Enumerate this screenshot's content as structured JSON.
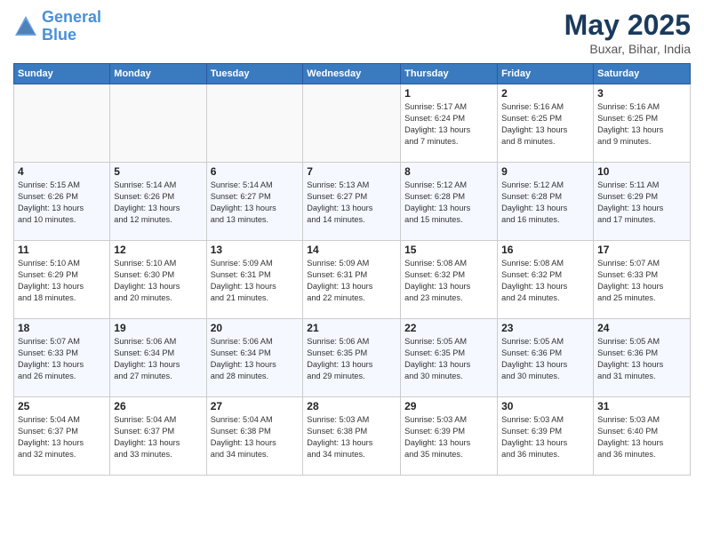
{
  "header": {
    "logo_line1": "General",
    "logo_line2": "Blue",
    "month": "May 2025",
    "location": "Buxar, Bihar, India"
  },
  "weekdays": [
    "Sunday",
    "Monday",
    "Tuesday",
    "Wednesday",
    "Thursday",
    "Friday",
    "Saturday"
  ],
  "weeks": [
    [
      {
        "day": "",
        "info": ""
      },
      {
        "day": "",
        "info": ""
      },
      {
        "day": "",
        "info": ""
      },
      {
        "day": "",
        "info": ""
      },
      {
        "day": "1",
        "info": "Sunrise: 5:17 AM\nSunset: 6:24 PM\nDaylight: 13 hours\nand 7 minutes."
      },
      {
        "day": "2",
        "info": "Sunrise: 5:16 AM\nSunset: 6:25 PM\nDaylight: 13 hours\nand 8 minutes."
      },
      {
        "day": "3",
        "info": "Sunrise: 5:16 AM\nSunset: 6:25 PM\nDaylight: 13 hours\nand 9 minutes."
      }
    ],
    [
      {
        "day": "4",
        "info": "Sunrise: 5:15 AM\nSunset: 6:26 PM\nDaylight: 13 hours\nand 10 minutes."
      },
      {
        "day": "5",
        "info": "Sunrise: 5:14 AM\nSunset: 6:26 PM\nDaylight: 13 hours\nand 12 minutes."
      },
      {
        "day": "6",
        "info": "Sunrise: 5:14 AM\nSunset: 6:27 PM\nDaylight: 13 hours\nand 13 minutes."
      },
      {
        "day": "7",
        "info": "Sunrise: 5:13 AM\nSunset: 6:27 PM\nDaylight: 13 hours\nand 14 minutes."
      },
      {
        "day": "8",
        "info": "Sunrise: 5:12 AM\nSunset: 6:28 PM\nDaylight: 13 hours\nand 15 minutes."
      },
      {
        "day": "9",
        "info": "Sunrise: 5:12 AM\nSunset: 6:28 PM\nDaylight: 13 hours\nand 16 minutes."
      },
      {
        "day": "10",
        "info": "Sunrise: 5:11 AM\nSunset: 6:29 PM\nDaylight: 13 hours\nand 17 minutes."
      }
    ],
    [
      {
        "day": "11",
        "info": "Sunrise: 5:10 AM\nSunset: 6:29 PM\nDaylight: 13 hours\nand 18 minutes."
      },
      {
        "day": "12",
        "info": "Sunrise: 5:10 AM\nSunset: 6:30 PM\nDaylight: 13 hours\nand 20 minutes."
      },
      {
        "day": "13",
        "info": "Sunrise: 5:09 AM\nSunset: 6:31 PM\nDaylight: 13 hours\nand 21 minutes."
      },
      {
        "day": "14",
        "info": "Sunrise: 5:09 AM\nSunset: 6:31 PM\nDaylight: 13 hours\nand 22 minutes."
      },
      {
        "day": "15",
        "info": "Sunrise: 5:08 AM\nSunset: 6:32 PM\nDaylight: 13 hours\nand 23 minutes."
      },
      {
        "day": "16",
        "info": "Sunrise: 5:08 AM\nSunset: 6:32 PM\nDaylight: 13 hours\nand 24 minutes."
      },
      {
        "day": "17",
        "info": "Sunrise: 5:07 AM\nSunset: 6:33 PM\nDaylight: 13 hours\nand 25 minutes."
      }
    ],
    [
      {
        "day": "18",
        "info": "Sunrise: 5:07 AM\nSunset: 6:33 PM\nDaylight: 13 hours\nand 26 minutes."
      },
      {
        "day": "19",
        "info": "Sunrise: 5:06 AM\nSunset: 6:34 PM\nDaylight: 13 hours\nand 27 minutes."
      },
      {
        "day": "20",
        "info": "Sunrise: 5:06 AM\nSunset: 6:34 PM\nDaylight: 13 hours\nand 28 minutes."
      },
      {
        "day": "21",
        "info": "Sunrise: 5:06 AM\nSunset: 6:35 PM\nDaylight: 13 hours\nand 29 minutes."
      },
      {
        "day": "22",
        "info": "Sunrise: 5:05 AM\nSunset: 6:35 PM\nDaylight: 13 hours\nand 30 minutes."
      },
      {
        "day": "23",
        "info": "Sunrise: 5:05 AM\nSunset: 6:36 PM\nDaylight: 13 hours\nand 30 minutes."
      },
      {
        "day": "24",
        "info": "Sunrise: 5:05 AM\nSunset: 6:36 PM\nDaylight: 13 hours\nand 31 minutes."
      }
    ],
    [
      {
        "day": "25",
        "info": "Sunrise: 5:04 AM\nSunset: 6:37 PM\nDaylight: 13 hours\nand 32 minutes."
      },
      {
        "day": "26",
        "info": "Sunrise: 5:04 AM\nSunset: 6:37 PM\nDaylight: 13 hours\nand 33 minutes."
      },
      {
        "day": "27",
        "info": "Sunrise: 5:04 AM\nSunset: 6:38 PM\nDaylight: 13 hours\nand 34 minutes."
      },
      {
        "day": "28",
        "info": "Sunrise: 5:03 AM\nSunset: 6:38 PM\nDaylight: 13 hours\nand 34 minutes."
      },
      {
        "day": "29",
        "info": "Sunrise: 5:03 AM\nSunset: 6:39 PM\nDaylight: 13 hours\nand 35 minutes."
      },
      {
        "day": "30",
        "info": "Sunrise: 5:03 AM\nSunset: 6:39 PM\nDaylight: 13 hours\nand 36 minutes."
      },
      {
        "day": "31",
        "info": "Sunrise: 5:03 AM\nSunset: 6:40 PM\nDaylight: 13 hours\nand 36 minutes."
      }
    ]
  ]
}
